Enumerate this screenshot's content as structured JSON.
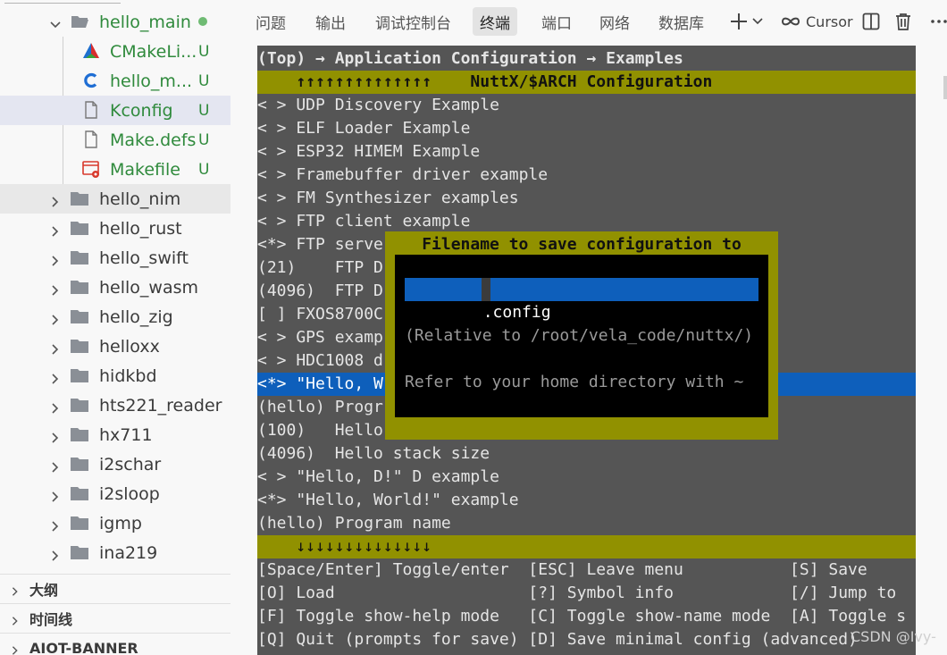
{
  "explorer": {
    "items": [
      {
        "label": "hello_main",
        "kind": "folder-open",
        "status": "dot"
      },
      {
        "label": "CMakeLi...",
        "kind": "cmake",
        "status": "U"
      },
      {
        "label": "hello_m...",
        "kind": "c",
        "status": "U"
      },
      {
        "label": "Kconfig",
        "kind": "file",
        "status": "U"
      },
      {
        "label": "Make.defs",
        "kind": "file",
        "status": "U"
      },
      {
        "label": "Makefile",
        "kind": "makefile",
        "status": "U"
      },
      {
        "label": "hello_nim",
        "kind": "folder"
      },
      {
        "label": "hello_rust",
        "kind": "folder"
      },
      {
        "label": "hello_swift",
        "kind": "folder"
      },
      {
        "label": "hello_wasm",
        "kind": "folder"
      },
      {
        "label": "hello_zig",
        "kind": "folder"
      },
      {
        "label": "helloxx",
        "kind": "folder"
      },
      {
        "label": "hidkbd",
        "kind": "folder"
      },
      {
        "label": "hts221_reader",
        "kind": "folder"
      },
      {
        "label": "hx711",
        "kind": "folder"
      },
      {
        "label": "i2schar",
        "kind": "folder"
      },
      {
        "label": "i2sloop",
        "kind": "folder"
      },
      {
        "label": "igmp",
        "kind": "folder"
      },
      {
        "label": "ina219",
        "kind": "folder"
      }
    ],
    "sections": [
      {
        "label": "大纲"
      },
      {
        "label": "时间线"
      },
      {
        "label": "AIOT-BANNER"
      }
    ]
  },
  "panel": {
    "tabs": [
      "问题",
      "输出",
      "调试控制台",
      "终端",
      "端口",
      "网络",
      "数据库"
    ],
    "active_tab": 3,
    "cursor_label": "Cursor"
  },
  "terminal": {
    "breadcrumb": "(Top) → Application Configuration → Examples",
    "header": "    ↑↑↑↑↑↑↑↑↑↑↑↑↑↑    NuttX/$ARCH Configuration",
    "lines": [
      "< > UDP Discovery Example",
      "< > ELF Loader Example",
      "< > ESP32 HIMEM Example",
      "< > Framebuffer driver example",
      "< > FM Synthesizer examples",
      "< > FTP client example",
      "<*> FTP serve",
      "(21)    FTP D",
      "(4096)  FTP D",
      "[ ] FXOS8700C",
      "< > GPS examp",
      "< > HDC1008 d",
      "<*> \"Hello, W",
      "(hello) Progr",
      "(100)   Hello",
      "(4096)  Hello stack size",
      "< > \"Hello, D!\" D example",
      "<*> \"Hello, World!\" example",
      "(hello) Program name"
    ],
    "highlight_index": 12,
    "footer_arrows": "    ↓↓↓↓↓↓↓↓↓↓↓↓↓↓",
    "help_lines": [
      "[Space/Enter] Toggle/enter  [ESC] Leave menu           [S] Save",
      "[O] Load                    [?] Symbol info            [/] Jump to",
      "[F] Toggle show-help mode   [C] Toggle show-name mode  [A] Toggle s",
      "[Q] Quit (prompts for save) [D] Save minimal config (advanced)"
    ],
    "dialog": {
      "title": "Filename to save configuration to",
      "value": ".config",
      "hint1": "(Relative to /root/vela_code/nuttx/)",
      "hint2": "Refer to your home directory with ~"
    }
  },
  "watermark": "CSDN @Ivy-",
  "colors": {
    "terminal_bg": "#555555",
    "bar": "#919100",
    "highlight": "#0e5fbb",
    "git_untracked": "#2f8a3c"
  }
}
